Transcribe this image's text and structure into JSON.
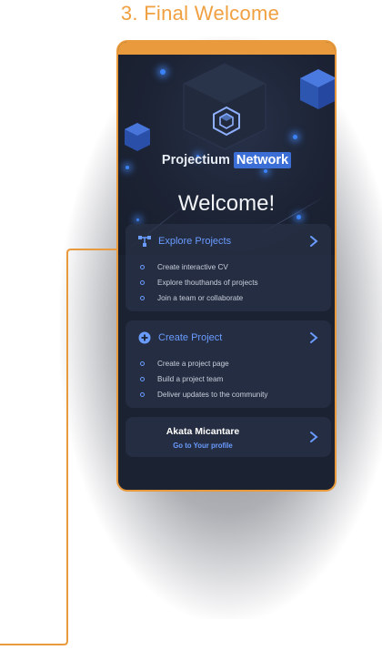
{
  "step_title": "3. Final Welcome",
  "brand": {
    "name": "Projectium",
    "highlight": "Network"
  },
  "welcome": "Welcome!",
  "cards": [
    {
      "title": "Explore Projects",
      "icon": "network-icon",
      "items": [
        "Create interactive CV",
        "Explore thouthands of projects",
        "Join a team or collaborate"
      ]
    },
    {
      "title": "Create Project",
      "icon": "plus-circle-icon",
      "items": [
        "Create a project page",
        "Build a project team",
        "Deliver updates to the community"
      ]
    }
  ],
  "profile": {
    "name": "Akata Micantare",
    "link": "Go to Your profile"
  },
  "colors": {
    "accent_orange": "#e89a3c",
    "accent_blue": "#6a9bff",
    "highlight_blue": "#3b6fd6",
    "background": "#1b2232"
  }
}
